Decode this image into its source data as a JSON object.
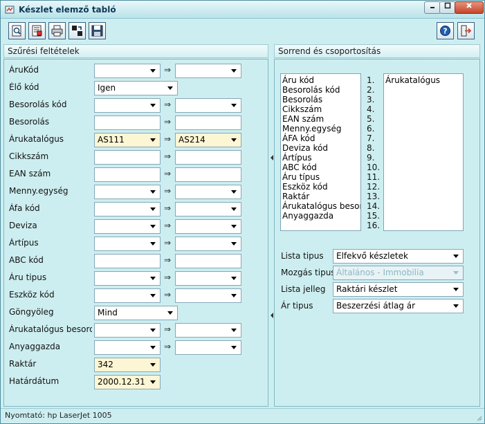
{
  "window": {
    "title": "Készlet elemző tabló",
    "accent": "#0e3a58",
    "background": "#cdeef0",
    "controls": [
      "minimize-icon",
      "maximize-icon",
      "close-icon"
    ]
  },
  "toolbar": {
    "left_buttons": [
      "preview-icon",
      "report-settings-icon",
      "printer-icon",
      "export-icon",
      "save-disk-icon"
    ],
    "right_buttons": [
      "help-icon",
      "exit-icon"
    ]
  },
  "filters": {
    "header": "Szűrési feltételek",
    "arrow": "⇒",
    "rows": [
      {
        "label": "ÁruKód",
        "from": "",
        "to": "",
        "range": true,
        "dropdown": true
      },
      {
        "label": "Élő kód",
        "value": "Igen",
        "range": false,
        "dropdown": true
      },
      {
        "label": "Besorolás kód",
        "from": "",
        "to": "",
        "range": true,
        "dropdown": true
      },
      {
        "label": "Besorolás",
        "from": "",
        "to": "",
        "range": true,
        "dropdown": false
      },
      {
        "label": "Árukatalógus",
        "from": "AS111",
        "to": "AS214",
        "range": true,
        "dropdown": true,
        "highlight": true
      },
      {
        "label": "Cikkszám",
        "from": "",
        "to": "",
        "range": true,
        "dropdown": false
      },
      {
        "label": "EAN szám",
        "from": "",
        "to": "",
        "range": true,
        "dropdown": false
      },
      {
        "label": "Menny.egység",
        "from": "",
        "to": "",
        "range": true,
        "dropdown": true
      },
      {
        "label": "Áfa kód",
        "from": "",
        "to": "",
        "range": true,
        "dropdown": true
      },
      {
        "label": "Deviza",
        "from": "",
        "to": "",
        "range": true,
        "dropdown": true
      },
      {
        "label": "Ártípus",
        "from": "",
        "to": "",
        "range": true,
        "dropdown": true
      },
      {
        "label": "ABC kód",
        "from": "",
        "to": "",
        "range": true,
        "dropdown": false
      },
      {
        "label": "Áru tipus",
        "from": "",
        "to": "",
        "range": true,
        "dropdown": true
      },
      {
        "label": "Eszköz kód",
        "from": "",
        "to": "",
        "range": true,
        "dropdown": true
      },
      {
        "label": "Göngyöleg",
        "value": "Mind",
        "range": false,
        "dropdown": true
      },
      {
        "label": "Árukatalógus besorolás",
        "from": "",
        "to": "",
        "range": true,
        "dropdown": true
      },
      {
        "label": "Anyaggazda",
        "from": "",
        "to": "",
        "range": true,
        "dropdown": true
      },
      {
        "label": "Raktár",
        "value": "342",
        "range": false,
        "dropdown": true,
        "highlight": true
      },
      {
        "label": "Határdátum",
        "value": "2000.12.31",
        "range": false,
        "dropdown": true,
        "highlight": true
      }
    ]
  },
  "sort": {
    "header": "Sorrend és csoportosítás",
    "available": [
      "Áru kód",
      "Besorolás kód",
      "Besorolás",
      "Cikkszám",
      "EAN szám",
      "Menny.egység",
      "ÁFA kód",
      "Deviza kód",
      "Ártípus",
      "ABC kód",
      "Áru típus",
      "Eszköz kód",
      "Raktár",
      "Árukatalógus besorolás",
      "Anyaggazda"
    ],
    "numbers": [
      "1.",
      "2.",
      "3.",
      "4.",
      "5.",
      "6.",
      "7.",
      "8.",
      "9.",
      "10.",
      "11.",
      "12.",
      "13.",
      "14.",
      "15.",
      "16."
    ],
    "selected": [
      "Árukatalógus"
    ]
  },
  "options": [
    {
      "label": "Lista tipus",
      "value": "Elfekvő készletek",
      "disabled": false
    },
    {
      "label": "Mozgás tipus",
      "value": "Általános - Immobilia",
      "disabled": true
    },
    {
      "label": "Lista jelleg",
      "value": "Raktári készlet",
      "disabled": false
    },
    {
      "label": "Ár tipus",
      "value": "Beszerzési átlag ár",
      "disabled": false
    }
  ],
  "status": {
    "printer": "Nyomtató: hp LaserJet 1005"
  }
}
